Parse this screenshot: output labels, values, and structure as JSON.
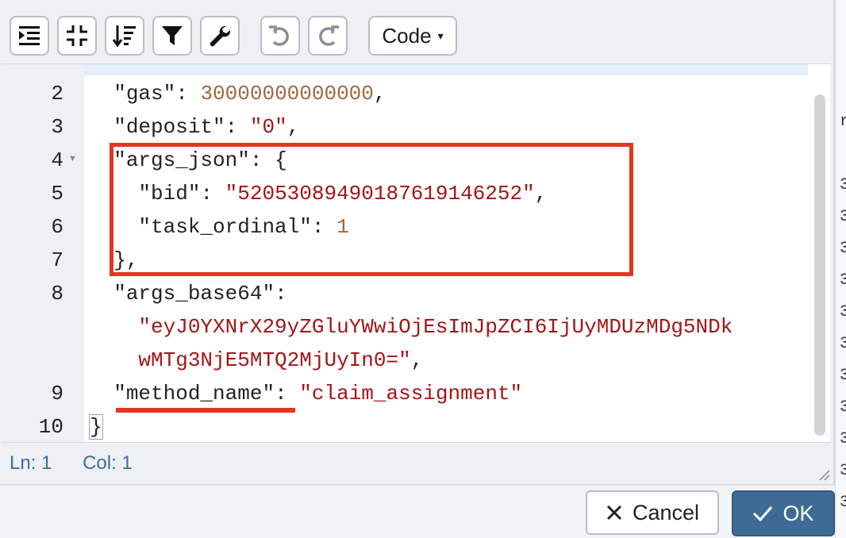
{
  "toolbar": {
    "buttons": [
      {
        "name": "indent-icon",
        "interactable": true
      },
      {
        "name": "collapse-icon",
        "interactable": true
      },
      {
        "name": "sort-icon",
        "interactable": true
      },
      {
        "name": "filter-icon",
        "interactable": true
      },
      {
        "name": "wrench-icon",
        "interactable": true
      },
      {
        "name": "undo-icon",
        "interactable": true
      },
      {
        "name": "redo-icon",
        "interactable": true
      }
    ],
    "mode_label": "Code",
    "mode_caret": "▾"
  },
  "editor": {
    "line_numbers": [
      "2",
      "3",
      "4",
      "5",
      "6",
      "7",
      "8",
      "9",
      "10"
    ],
    "lines": {
      "l2_key": "\"gas\"",
      "l2_sep": ": ",
      "l2_val": "30000000000000",
      "l2_end": ",",
      "l3_key": "\"deposit\"",
      "l3_sep": ": ",
      "l3_val": "\"0\"",
      "l3_end": ",",
      "l4_key": "\"args_json\"",
      "l4_rest": ": {",
      "l5_key": "\"bid\"",
      "l5_sep": ": ",
      "l5_val": "\"5205308949018761914625​2\"",
      "l5_end": ",",
      "l6_key": "\"task_ordinal\"",
      "l6_sep": ": ",
      "l6_val": "1",
      "l7": "},",
      "l8_key": "\"args_base64\"",
      "l8_sep": ":",
      "l8_val1": "\"eyJ0YXNrX29yZGluYWwiOjEsImJpZCI6IjUyMDUzMDg5NDk",
      "l8_val2": "wMTg3NjE5MTQ2MjUyIn0=\"",
      "l8_end": ",",
      "l9_key": "\"method_name\"",
      "l9_sep": ": ",
      "l9_val": "\"claim_assignment\"",
      "l10": "}"
    },
    "colors": {
      "number": "#a0683f",
      "string": "#a31515",
      "highlight": "#e3361f"
    }
  },
  "status": {
    "ln": "Ln: 1",
    "col": "Col: 1"
  },
  "footer": {
    "cancel_label": "Cancel",
    "ok_label": "OK"
  },
  "side_marks": [
    "r",
    "3",
    "3",
    "3",
    "3",
    "3",
    "3",
    "3",
    "3",
    "3",
    "3",
    "3"
  ]
}
